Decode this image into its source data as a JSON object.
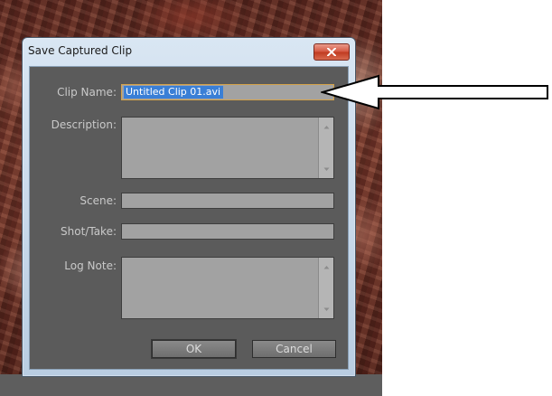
{
  "dialog": {
    "title": "Save Captured Clip",
    "close_icon": "close-x-icon",
    "accent_color": "#3a7fd6"
  },
  "fields": {
    "clip_name": {
      "label": "Clip Name:",
      "value": "Untitled Clip 01.avi"
    },
    "description": {
      "label": "Description:",
      "value": ""
    },
    "scene": {
      "label": "Scene:",
      "value": ""
    },
    "shot_take": {
      "label": "Shot/Take:",
      "value": ""
    },
    "log_note": {
      "label": "Log Note:",
      "value": ""
    }
  },
  "buttons": {
    "ok": "OK",
    "cancel": "Cancel"
  },
  "annotation": {
    "icon": "left-arrow-icon"
  }
}
